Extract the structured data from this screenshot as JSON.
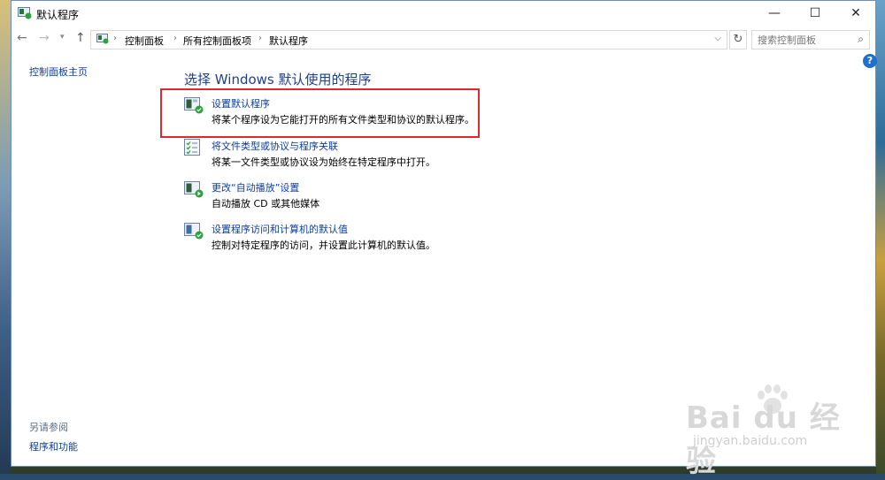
{
  "window": {
    "title": "默认程序"
  },
  "titlebar": {
    "minimize": "—",
    "maximize": "☐",
    "close": "✕"
  },
  "nav": {
    "back": "←",
    "forward": "→",
    "dropdown": "▾",
    "up": "↑",
    "breadcrumbs": [
      "控制面板",
      "所有控制面板项",
      "默认程序"
    ],
    "sep": "›",
    "address_dropdown": "⌵",
    "refresh": "↻",
    "search_placeholder": "搜索控制面板",
    "search_icon": "⌕"
  },
  "help": "?",
  "sidebar": {
    "home": "控制面板主页",
    "see_also": "另请参阅",
    "programs_features": "程序和功能"
  },
  "main": {
    "title": "选择 Windows 默认使用的程序",
    "items": [
      {
        "icon": "default-programs-icon",
        "link": "设置默认程序",
        "desc": "将某个程序设为它能打开的所有文件类型和协议的默认程序。"
      },
      {
        "icon": "file-association-icon",
        "link": "将文件类型或协议与程序关联",
        "desc": "将某一文件类型或协议设为始终在特定程序中打开。"
      },
      {
        "icon": "autoplay-icon",
        "link": "更改“自动播放”设置",
        "desc": "自动播放 CD 或其他媒体"
      },
      {
        "icon": "program-access-icon",
        "link": "设置程序访问和计算机的默认值",
        "desc": "控制对特定程序的访问，并设置此计算机的默认值。"
      }
    ]
  },
  "watermark": {
    "brand": "Bai du 经验",
    "url": "jingyan.baidu.com"
  },
  "colors": {
    "link": "#0c3ea0",
    "title": "#1e3f8a",
    "highlight": "#e0292e"
  }
}
